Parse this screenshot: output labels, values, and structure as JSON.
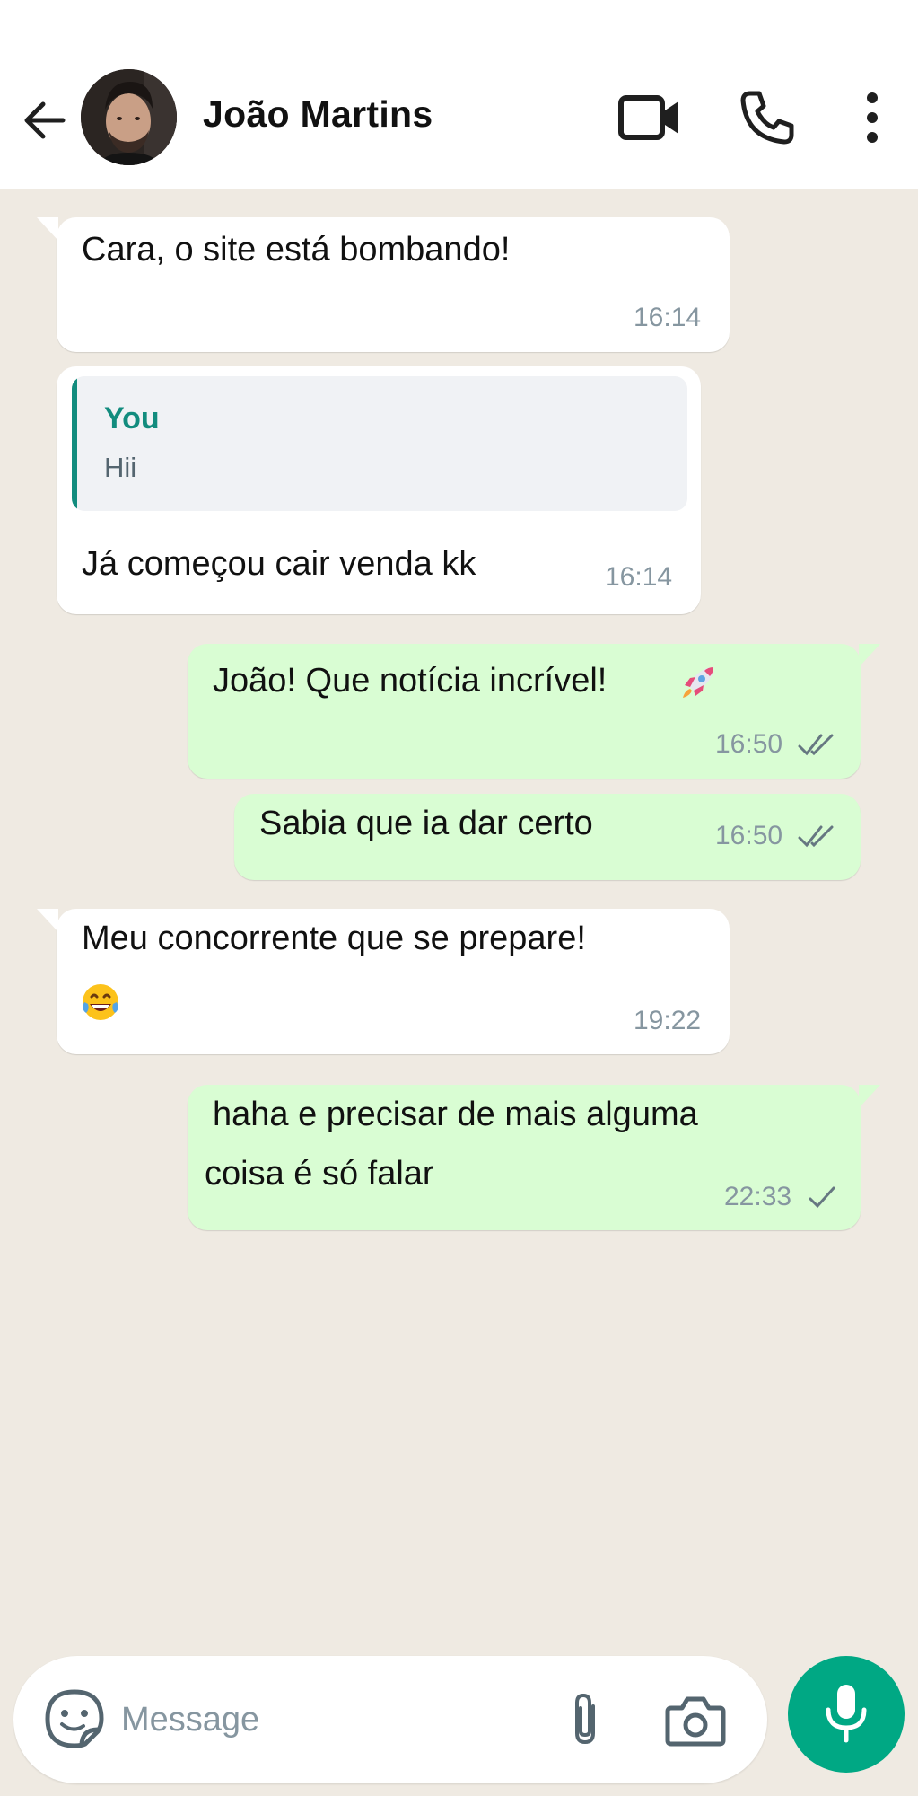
{
  "header": {
    "contact_name": "João Martins",
    "icons": [
      "back-arrow-icon",
      "video-call-icon",
      "phone-call-icon",
      "more-options-icon"
    ]
  },
  "messages": [
    {
      "direction": "incoming",
      "text": "Cara, o site está bombando!",
      "time": "16:14"
    },
    {
      "direction": "incoming",
      "quote": {
        "author": "You",
        "text": "Hii"
      },
      "text": "Já começou cair venda kk",
      "time": "16:14"
    },
    {
      "direction": "outgoing",
      "text": "João! Que notícia incrível!",
      "emoji": "rocket",
      "time": "16:50",
      "status": "delivered"
    },
    {
      "direction": "outgoing",
      "text": "Sabia que ia dar certo",
      "time": "16:50",
      "status": "delivered"
    },
    {
      "direction": "incoming",
      "text": "Meu concorrente que se prepare!",
      "emoji": "face-with-tears-of-joy",
      "time": "19:22"
    },
    {
      "direction": "outgoing",
      "text_line1": "haha e precisar de mais alguma",
      "text_line2": "coisa é só falar",
      "time": "22:33",
      "status": "sent"
    }
  ],
  "composer": {
    "placeholder": "Message",
    "icons": [
      "sticker-icon",
      "attach-icon",
      "camera-icon",
      "mic-icon"
    ]
  },
  "colors": {
    "chat_background": "#efeae2",
    "incoming_bubble": "#ffffff",
    "outgoing_bubble": "#d9fdd3",
    "accent": "#00a884",
    "quote_author": "#128c7e",
    "time": "#8696a0"
  }
}
